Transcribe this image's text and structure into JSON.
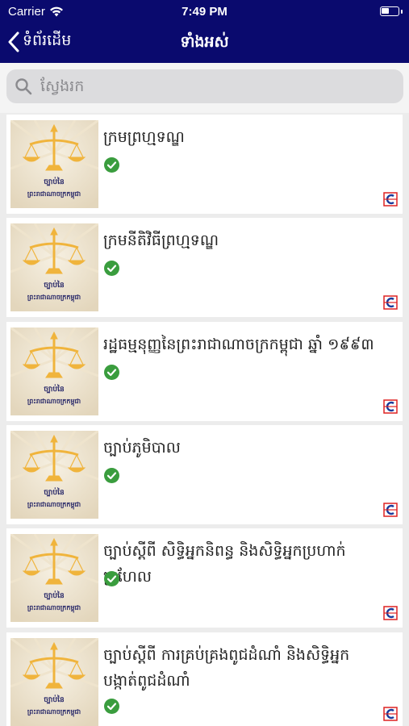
{
  "status_bar": {
    "carrier": "Carrier",
    "time": "7:49 PM"
  },
  "nav": {
    "back_label": "ទំព័រដើម",
    "title": "ទាំងអស់"
  },
  "search": {
    "placeholder": "ស្វែងរក"
  },
  "thumbnail": {
    "line1": "ច្បាប់នៃ",
    "line2": "ព្រះរាជាណាចក្រកម្ពុជា"
  },
  "items": [
    {
      "title": "ក្រមព្រហ្មទណ្ឌ"
    },
    {
      "title": "ក្រមនីតិវិធីព្រហ្មទណ្ឌ"
    },
    {
      "title": "រដ្ឋធម្មនុញ្ញនៃព្រះរាជាណាចក្រកម្ពុជា ឆ្នាំ ១៩៩៣"
    },
    {
      "title": "ច្បាប់ភូមិបាល"
    },
    {
      "title": "ច្បាប់ស្ដីពី សិទ្ធិអ្នកនិពន្ធ និងសិទ្ធិអ្នកប្រហាក់ប្រហែល"
    },
    {
      "title": "ច្បាប់ស្ដីពី ការគ្រប់គ្រងពូជដំណាំ និងសិទ្ធិអ្នកបង្កាត់ពូជដំណាំ"
    }
  ],
  "colors": {
    "nav_bg": "#0a0a6e",
    "check": "#3a9d3e",
    "thumb_gold": "#f0b43c"
  },
  "icons": [
    "back-chevron-icon",
    "search-icon",
    "check-icon",
    "wifi-icon",
    "battery-icon",
    "publisher-logo-icon"
  ]
}
